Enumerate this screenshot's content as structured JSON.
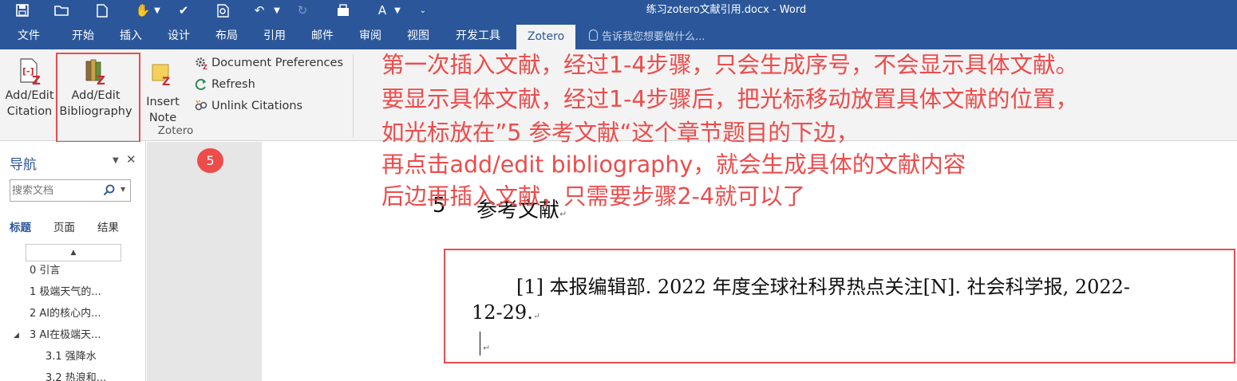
{
  "title_bar": {
    "document_title": "练习zotero文献引用.docx - Word",
    "quick_access": [
      "save-icon",
      "open-icon",
      "new-icon",
      "touch-mode-icon",
      "spelling-icon",
      "print-preview-icon",
      "undo-icon",
      "redo-icon",
      "zotero-sync-icon",
      "font-color-icon",
      "customize-icon"
    ]
  },
  "ribbon_tabs": [
    "文件",
    "开始",
    "插入",
    "设计",
    "布局",
    "引用",
    "邮件",
    "审阅",
    "视图",
    "开发工具",
    "Zotero"
  ],
  "active_tab": "Zotero",
  "tell_me": "告诉我您想要做什么...",
  "zotero_group": {
    "label": "Zotero",
    "add_edit_citation": [
      "Add/Edit",
      "Citation"
    ],
    "add_edit_bibliography": [
      "Add/Edit",
      "Bibliography"
    ],
    "insert_note": [
      "Insert",
      "Note"
    ],
    "document_preferences": "Document Preferences",
    "refresh": "Refresh",
    "unlink_citations": "Unlink Citations"
  },
  "navigation": {
    "title": "导航",
    "search_placeholder": "搜索文档",
    "tabs": [
      "标题",
      "页面",
      "结果"
    ],
    "active_tab": "标题",
    "collapse_glyph": "▲",
    "items": [
      {
        "text": "0 引言",
        "level": 1
      },
      {
        "text": "1 极端天气的...",
        "level": 1
      },
      {
        "text": "2 AI的核心内...",
        "level": 1
      },
      {
        "text": "3 AI在极端天...",
        "level": 1,
        "expanded": true
      },
      {
        "text": "3.1 强降水",
        "level": 2
      },
      {
        "text": "3.2 热浪和...",
        "level": 2
      }
    ]
  },
  "step_badge": "5",
  "document": {
    "heading_number": "5",
    "heading_text": "参考文献",
    "paragraph_mark": "↵",
    "bibliography": {
      "line1": "[1]  本报编辑部. 2022  年度全球社科界热点关注[N].  社会科学报, 2022-",
      "line2": "12-29."
    }
  },
  "annotation": [
    "第一次插入文献，经过1-4步骤，只会生成序号，不会显示具体文献。",
    "要显示具体文献，经过1-4步骤后，把光标移动放置具体文献的位置，",
    "如光标放在”5 参考文献“这个章节题目的下边，",
    "再点击add/edit bibliography，就会生成具体的文献内容",
    "后边再插入文献，只需要步骤2-4就可以了"
  ],
  "colors": {
    "word_blue": "#2b579a",
    "ribbon_bg": "#f3f3f3",
    "annotation_red": "#ee4b4b",
    "zotero_red": "#cc2936"
  }
}
